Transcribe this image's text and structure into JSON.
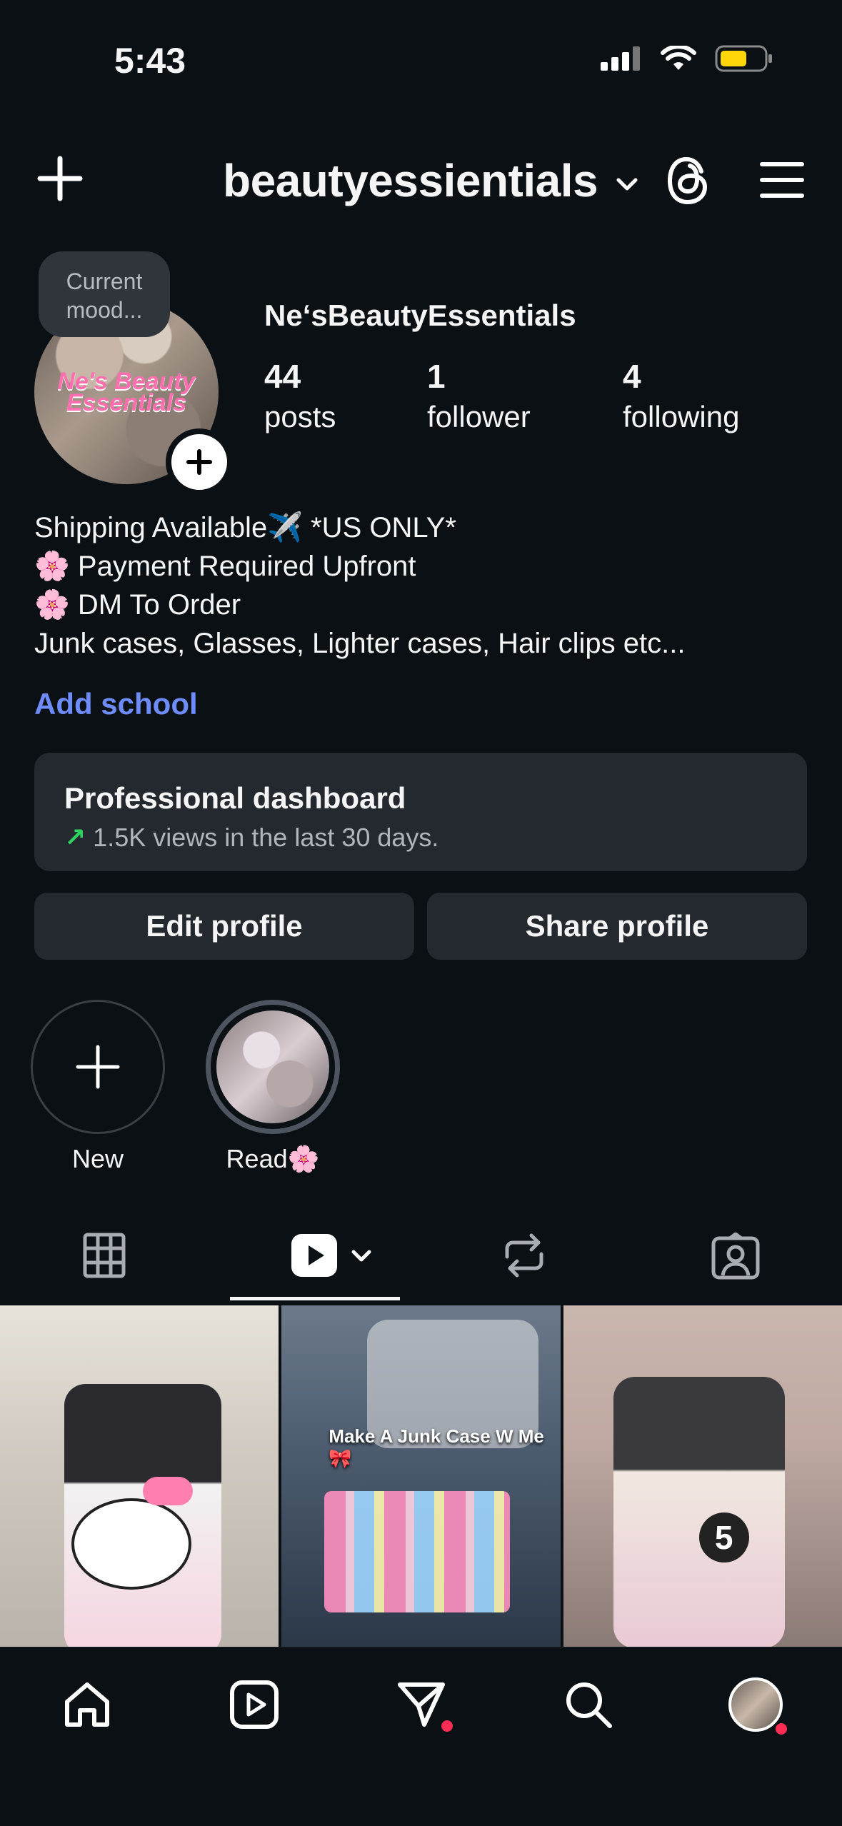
{
  "status_bar": {
    "time": "5:43"
  },
  "header": {
    "username": "beautyessientials"
  },
  "profile": {
    "mood_bubble": "Current mood...",
    "avatar_text": "Ne's Beauty Essentials",
    "display_name": "Ne‘sBeautyEssentials",
    "stats": [
      {
        "value": "44",
        "label": "posts"
      },
      {
        "value": "1",
        "label": "follower"
      },
      {
        "value": "4",
        "label": "following"
      }
    ],
    "bio": [
      "Shipping Available✈️ *US ONLY*",
      "🌸 Payment Required Upfront",
      "🌸 DM To Order",
      "Junk cases, Glasses, Lighter cases, Hair clips etc..."
    ],
    "add_school": "Add school"
  },
  "dashboard": {
    "title": "Professional dashboard",
    "subtitle": "1.5K views in the last 30 days."
  },
  "buttons": {
    "edit_profile": "Edit profile",
    "share_profile": "Share profile"
  },
  "highlights": [
    {
      "label": "New"
    },
    {
      "label": "Read🌸"
    }
  ],
  "tabs": [
    "grid",
    "reels",
    "reposts",
    "tagged"
  ],
  "posts": [
    {
      "caption": ""
    },
    {
      "caption": "Make A Junk Case W Me 🎀"
    },
    {
      "caption": ""
    }
  ],
  "colors": {
    "background": "#0b1014",
    "link": "#6f8cff",
    "surface": "#24292f",
    "trend_green": "#2fd25f",
    "notification_red": "#ff2d55",
    "battery_yellow": "#ffd60a"
  }
}
